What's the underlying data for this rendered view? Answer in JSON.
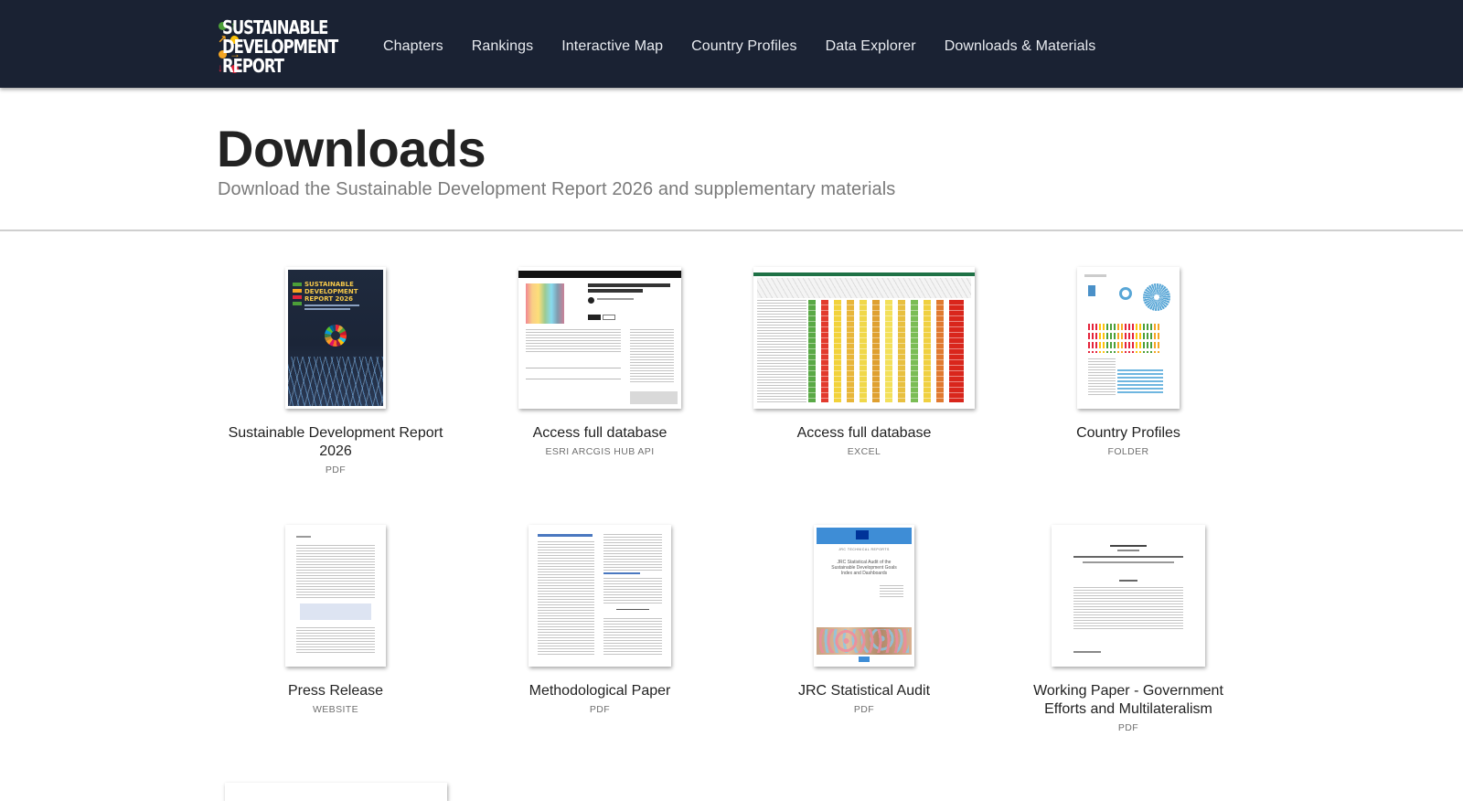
{
  "header": {
    "logo_lines": [
      "SUSTAINABLE",
      "DEVELOPMENT",
      "REPORT"
    ],
    "nav": [
      "Chapters",
      "Rankings",
      "Interactive Map",
      "Country Profiles",
      "Data Explorer",
      "Downloads & Materials"
    ]
  },
  "page": {
    "title": "Downloads",
    "subtitle": "Download the Sustainable Development Report 2026 and supplementary materials"
  },
  "downloads": [
    {
      "title": "Sustainable Development Report 2026",
      "type": "PDF",
      "cover_lines": [
        "SUSTAINABLE",
        "DEVELOPMENT",
        "REPORT 2026"
      ]
    },
    {
      "title": "Access full database",
      "type": "ESRI ARCGIS HUB API"
    },
    {
      "title": "Access full database",
      "type": "EXCEL"
    },
    {
      "title": "Country Profiles",
      "type": "FOLDER"
    },
    {
      "title": "Press Release",
      "type": "WEBSITE"
    },
    {
      "title": "Methodological Paper",
      "type": "PDF"
    },
    {
      "title": "JRC Statistical Audit",
      "type": "PDF",
      "cover_lines": [
        "JRC TECHNICAL REPORTS",
        "JRC Statistical Audit of the",
        "Sustainable Development Goals",
        "Index and Dashboards"
      ]
    },
    {
      "title": "Working Paper - Government Efforts and Multilateralism",
      "type": "PDF"
    }
  ],
  "colors": {
    "header_bg": "#1a2233",
    "green": "#4c9f38",
    "orange": "#f5a623",
    "red": "#e5243b",
    "yellow": "#fcc30b"
  }
}
